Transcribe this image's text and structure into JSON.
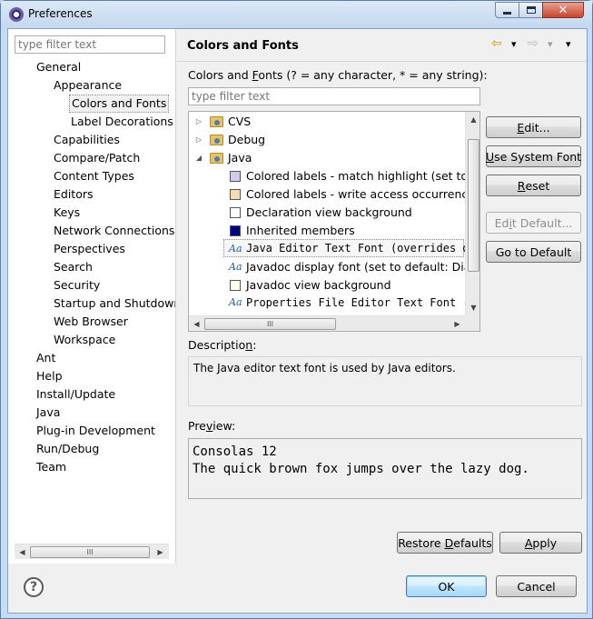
{
  "window": {
    "title": "Preferences",
    "close_glyph": "✕"
  },
  "left": {
    "filter_placeholder": "type filter text",
    "items": [
      "General",
      "Appearance",
      "Colors and Fonts",
      "Label Decorations",
      "Capabilities",
      "Compare/Patch",
      "Content Types",
      "Editors",
      "Keys",
      "Network Connections",
      "Perspectives",
      "Search",
      "Security",
      "Startup and Shutdown",
      "Web Browser",
      "Workspace",
      "Ant",
      "Help",
      "Install/Update",
      "Java",
      "Plug-in Development",
      "Run/Debug",
      "Team"
    ],
    "scroll_thumb": "III"
  },
  "page": {
    "title": "Colors and Fonts",
    "nav": {
      "back": "⇦",
      "back_menu": "▾",
      "forward": "⇨",
      "forward_menu": "▾",
      "view_menu": "▾"
    },
    "filter_label_pre": "Colors and ",
    "filter_label_ul": "F",
    "filter_label_post": "onts (? = any character, * = any string):",
    "filter_placeholder": "type filter text",
    "tree": {
      "twisty_collapsed": "▷",
      "twisty_expanded": "◢",
      "aa": "Aa",
      "groups": [
        "CVS",
        "Debug",
        "Java"
      ],
      "items": [
        {
          "label": "Colored labels - match highlight (set to d",
          "swatch": "#d3c9ef"
        },
        {
          "label": "Colored labels - write access occurrences",
          "swatch": "#f4dcb0"
        },
        {
          "label": "Declaration view background",
          "swatch": "#ffffff"
        },
        {
          "label": "Inherited members",
          "swatch": "#000080"
        },
        {
          "label": "Java Editor Text Font (overrides d"
        },
        {
          "label": "Javadoc display font (set to default: Dialc"
        },
        {
          "label": "Javadoc view background",
          "swatch": "#fffff0"
        },
        {
          "label": "Properties File Editor Text Font ("
        }
      ],
      "scroll_thumb": "III"
    },
    "buttons": {
      "edit_ul": "E",
      "edit_rest": "dit...",
      "use_system_ul": "U",
      "use_system_rest": "se System Font",
      "reset_ul": "R",
      "reset_rest": "eset",
      "edit_default_pre": "Ed",
      "edit_default_ul": "i",
      "edit_default_post": "t Default...",
      "go_default": "Go to Default"
    },
    "description_label_pre": "Descriptio",
    "description_label_ul": "n",
    "description_label_post": ":",
    "description_text": "The Java editor text font is used by Java editors.",
    "preview_label_pre": "Pre",
    "preview_label_ul": "v",
    "preview_label_post": "iew:",
    "preview_line1": "Consolas 12",
    "preview_line2": "The quick brown fox jumps over the lazy dog.",
    "restore_pre": "Restore ",
    "restore_ul": "D",
    "restore_post": "efaults",
    "apply_ul": "A",
    "apply_rest": "pply"
  },
  "footer": {
    "help_glyph": "?",
    "ok": "OK",
    "cancel": "Cancel"
  }
}
